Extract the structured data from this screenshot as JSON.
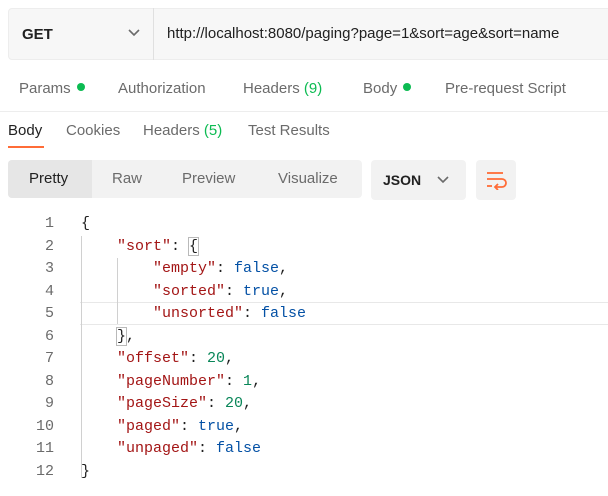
{
  "request": {
    "method": "GET",
    "url": "http://localhost:8080/paging?page=1&sort=age&sort=name"
  },
  "request_tabs": [
    {
      "label": "Params",
      "has_dot": true
    },
    {
      "label": "Authorization"
    },
    {
      "label": "Headers",
      "count": "(9)"
    },
    {
      "label": "Body",
      "has_dot": true
    },
    {
      "label": "Pre-request Script"
    }
  ],
  "response_tabs": [
    {
      "label": "Body",
      "active": true
    },
    {
      "label": "Cookies"
    },
    {
      "label": "Headers",
      "count": "(5)"
    },
    {
      "label": "Test Results"
    }
  ],
  "format_options": [
    "Pretty",
    "Raw",
    "Preview",
    "Visualize"
  ],
  "active_format": "Pretty",
  "language": "JSON",
  "body_lines": [
    {
      "n": "1",
      "text": "{"
    },
    {
      "n": "2",
      "text": "\"sort\": {"
    },
    {
      "n": "3",
      "text": "\"empty\": false,"
    },
    {
      "n": "4",
      "text": "\"sorted\": true,"
    },
    {
      "n": "5",
      "text": "\"unsorted\": false"
    },
    {
      "n": "6",
      "text": "},"
    },
    {
      "n": "7",
      "text": "\"offset\": 20,"
    },
    {
      "n": "8",
      "text": "\"pageNumber\": 1,"
    },
    {
      "n": "9",
      "text": "\"pageSize\": 20,"
    },
    {
      "n": "10",
      "text": "\"paged\": true,"
    },
    {
      "n": "11",
      "text": "\"unpaged\": false"
    },
    {
      "n": "12",
      "text": "}"
    }
  ],
  "colors": {
    "accent": "#ff6c37",
    "dot_green": "#0cbb52",
    "json_key": "#a31515",
    "json_bool": "#0451a5",
    "json_number": "#098658"
  },
  "icons": [
    "chevron-down-icon",
    "wrap-lines-icon"
  ]
}
